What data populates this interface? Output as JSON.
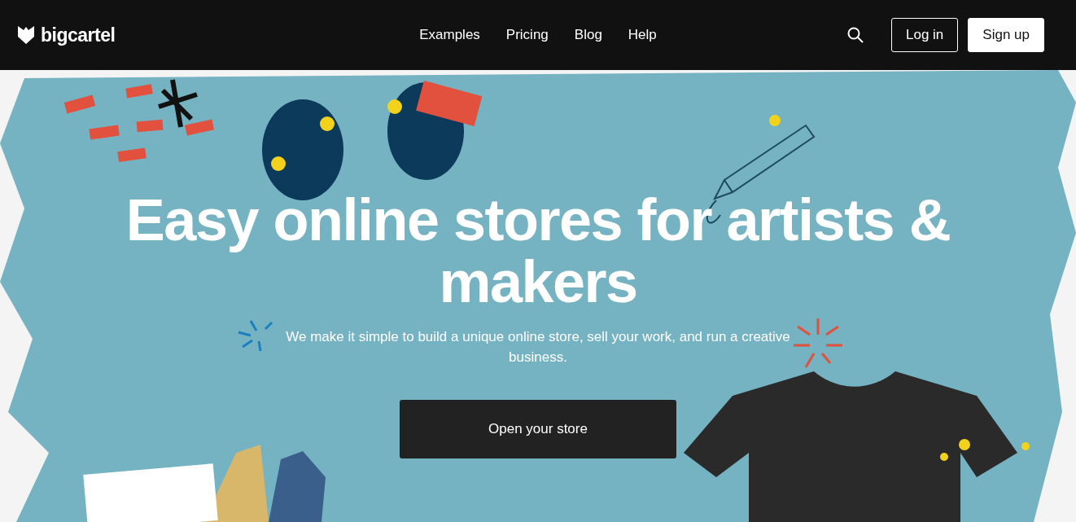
{
  "header": {
    "logo": "bigcartel",
    "nav": [
      "Examples",
      "Pricing",
      "Blog",
      "Help"
    ],
    "login": "Log in",
    "signup": "Sign up"
  },
  "hero": {
    "title": "Easy online stores for artists & makers",
    "subtitle": "We make it simple to build a unique online store, sell your work, and run a creative business.",
    "cta": "Open your store"
  }
}
